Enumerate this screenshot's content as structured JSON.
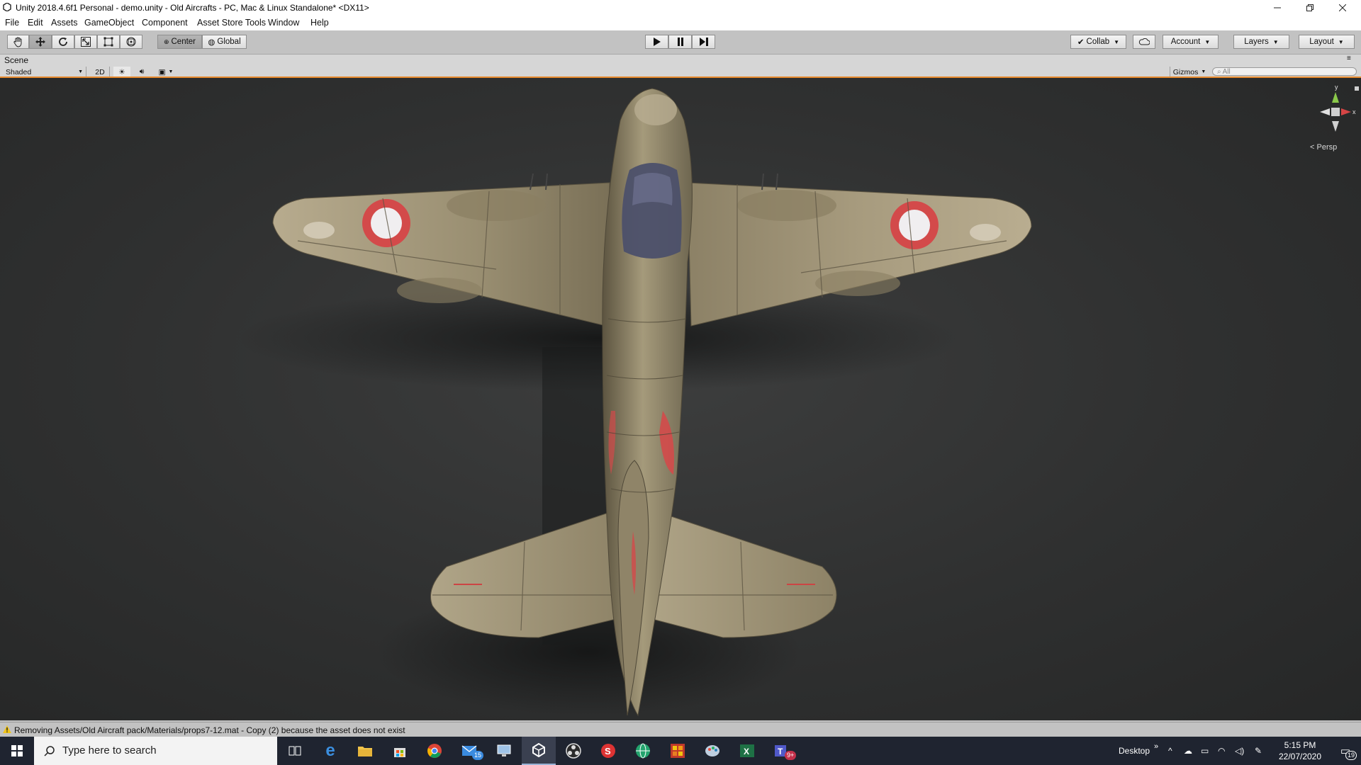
{
  "window": {
    "title": "Unity 2018.4.6f1 Personal - demo.unity - Old Aircrafts - PC, Mac & Linux Standalone* <DX11>"
  },
  "menu": {
    "items": [
      "File",
      "Edit",
      "Assets",
      "GameObject",
      "Component",
      "Asset Store Tools",
      "Window",
      "Help"
    ]
  },
  "toolbar": {
    "pivot_mode": "Center",
    "pivot_rotation": "Global",
    "collab": "Collab",
    "account": "Account",
    "layers": "Layers",
    "layout": "Layout"
  },
  "scene": {
    "tab_label": "Scene",
    "draw_mode": "Shaded",
    "mode_2d": "2D",
    "gizmos": "Gizmos",
    "search_placeholder": "All",
    "projection": "Persp",
    "gizmo_axes": [
      "y",
      "x"
    ]
  },
  "status": {
    "message": "Removing Assets/Old Aircraft pack/Materials/props7-12.mat - Copy (2) because the asset does not exist"
  },
  "taskbar": {
    "search_placeholder": "Type here to search",
    "mail_badge": "15",
    "teams_badge": "9+",
    "desktop_label": "Desktop",
    "time": "5:15 PM",
    "date": "22/07/2020",
    "notification_count": "19"
  },
  "colors": {
    "accent_orange": "#e6892d",
    "viewport_bg": "#2f3030",
    "taskbar_bg": "#1f2430"
  }
}
